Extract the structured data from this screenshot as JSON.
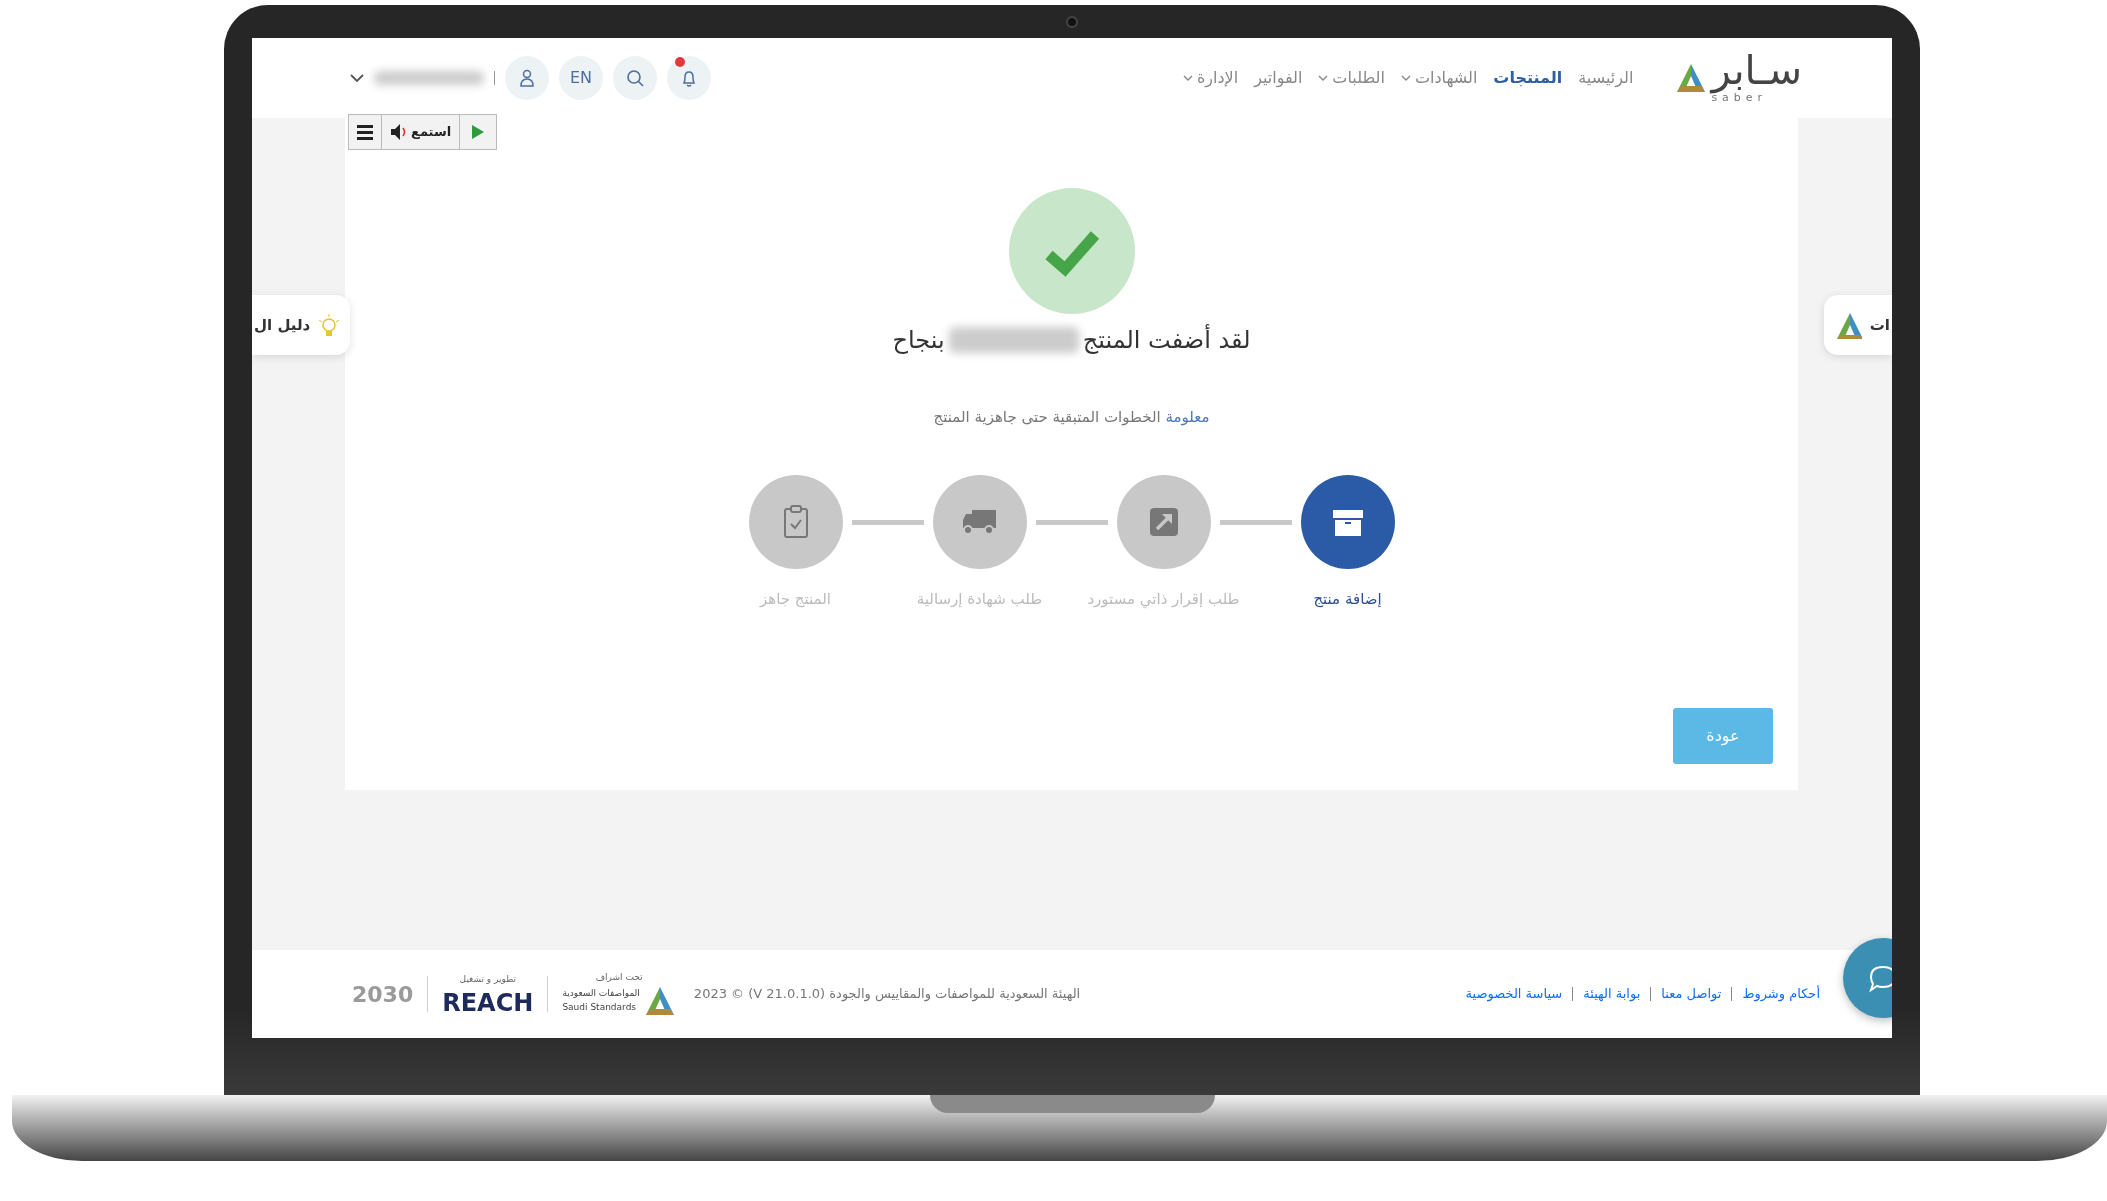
{
  "header": {
    "logo_text": "سـابر",
    "logo_subtext": "saber",
    "nav": [
      {
        "label": "الرئيسية",
        "selected": false,
        "dropdown": false
      },
      {
        "label": "المنتجات",
        "selected": true,
        "dropdown": false
      },
      {
        "label": "الشهادات",
        "selected": false,
        "dropdown": true
      },
      {
        "label": "الطلبات",
        "selected": false,
        "dropdown": true
      },
      {
        "label": "الفواتير",
        "selected": false,
        "dropdown": false
      },
      {
        "label": "الإدارة",
        "selected": false,
        "dropdown": true
      }
    ],
    "has_notification": true,
    "language": "EN"
  },
  "listen_toolbar": {
    "label": "استمع"
  },
  "side_tabs": [
    {
      "kind": "logo",
      "label": "ات"
    },
    {
      "kind": "guide",
      "label": "دليل ال"
    }
  ],
  "success": {
    "title_start": "لقد أضفت المنتج",
    "title_end": "بنجاح",
    "info_link": "معلومة",
    "info_text": "الخطوات المتبقية حتى جاهزية المنتج"
  },
  "steps": [
    {
      "kind": "box",
      "label": "إضافة منتج",
      "selected": true
    },
    {
      "kind": "external-link",
      "label": "طلب إقرار ذاتي مستورد",
      "selected": false
    },
    {
      "kind": "truck",
      "label": "طلب شهادة إرسالية",
      "selected": false
    },
    {
      "kind": "clipboard",
      "label": "المنتج جاهز",
      "selected": false
    }
  ],
  "back_button": "عودة",
  "footer": {
    "links": [
      "أحكام وشروط",
      "تواصل معنا",
      "بوابة الهيئة",
      "سياسة الخصوصية"
    ],
    "copyright": "الهيئة السعودية للمواصفات والمقاييس والجودة (V 21.0.1.0) © 2023",
    "supervision_label": "تحت اشراف",
    "standards_ar": "المواصفات السعودية",
    "standards_en": "Saudi Standards",
    "operation_label": "تطوير و تشغيل",
    "reach": "REACH",
    "vision": "2030"
  }
}
